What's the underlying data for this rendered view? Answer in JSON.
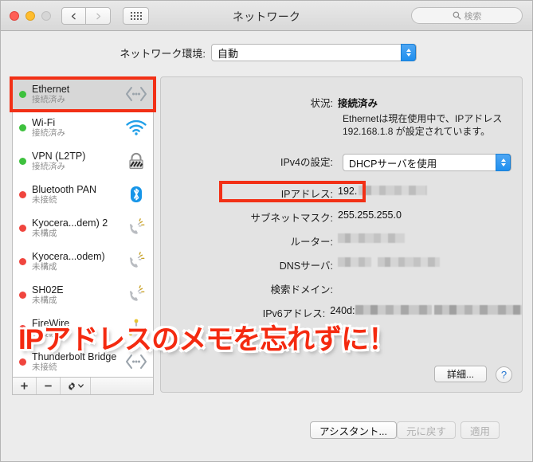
{
  "window": {
    "title": "ネットワーク",
    "search_placeholder": "検索",
    "search_value": ""
  },
  "environment": {
    "label": "ネットワーク環境:",
    "value": "自動"
  },
  "sidebar": {
    "items": [
      {
        "name": "Ethernet",
        "status": "接続済み",
        "dot": "green",
        "icon": "ethernet-icon",
        "selected": true
      },
      {
        "name": "Wi-Fi",
        "status": "接続済み",
        "dot": "green",
        "icon": "wifi-icon",
        "selected": false
      },
      {
        "name": "VPN (L2TP)",
        "status": "接続済み",
        "dot": "green",
        "icon": "vpn-lock-icon",
        "selected": false
      },
      {
        "name": "Bluetooth PAN",
        "status": "未接続",
        "dot": "red",
        "icon": "bluetooth-icon",
        "selected": false
      },
      {
        "name": "Kyocera...dem) 2",
        "status": "未構成",
        "dot": "red",
        "icon": "modem-icon",
        "selected": false
      },
      {
        "name": "Kyocera...odem)",
        "status": "未構成",
        "dot": "red",
        "icon": "modem-icon",
        "selected": false
      },
      {
        "name": "SH02E",
        "status": "未構成",
        "dot": "red",
        "icon": "modem-icon",
        "selected": false
      },
      {
        "name": "FireWire",
        "status": "未接続",
        "dot": "red",
        "icon": "firewire-icon",
        "selected": false
      },
      {
        "name": "Thunderbolt Bridge",
        "status": "未接続",
        "dot": "red",
        "icon": "thunderbolt-icon",
        "selected": false
      }
    ],
    "toolbar": {
      "add_label": "+",
      "remove_label": "−",
      "gear_label": "✾"
    }
  },
  "details": {
    "status_label": "状況:",
    "status_value": "接続済み",
    "status_description": "Ethernetは現在使用中で、IPアドレス 192.168.1.8 が設定されています。",
    "ipv4_label": "IPv4の設定:",
    "ipv4_value": "DHCPサーバを使用",
    "rows": [
      {
        "label": "IPアドレス:",
        "value": "192.",
        "redacted": true,
        "redacted_width": 86
      },
      {
        "label": "サブネットマスク:",
        "value": "255.255.255.0",
        "redacted": false,
        "redacted_width": 0
      },
      {
        "label": "ルーター:",
        "value": "",
        "redacted": true,
        "redacted_width": 84
      },
      {
        "label": "DNSサーバ:",
        "value": "",
        "redacted": true,
        "redacted_width": 132
      },
      {
        "label": "検索ドメイン:",
        "value": "",
        "redacted": false,
        "redacted_width": 0
      },
      {
        "label": "IPv6アドレス:",
        "value": "240d:",
        "redacted": true,
        "redacted_width": 212
      }
    ],
    "advanced_button": "詳細...",
    "help_button": "?"
  },
  "footer": {
    "assistant_button": "アシスタント...",
    "revert_button": "元に戻す",
    "apply_button": "適用"
  },
  "annotation": {
    "callout_text": "IPアドレスのメモを忘れずに！",
    "highlight_color": "#f23016"
  }
}
